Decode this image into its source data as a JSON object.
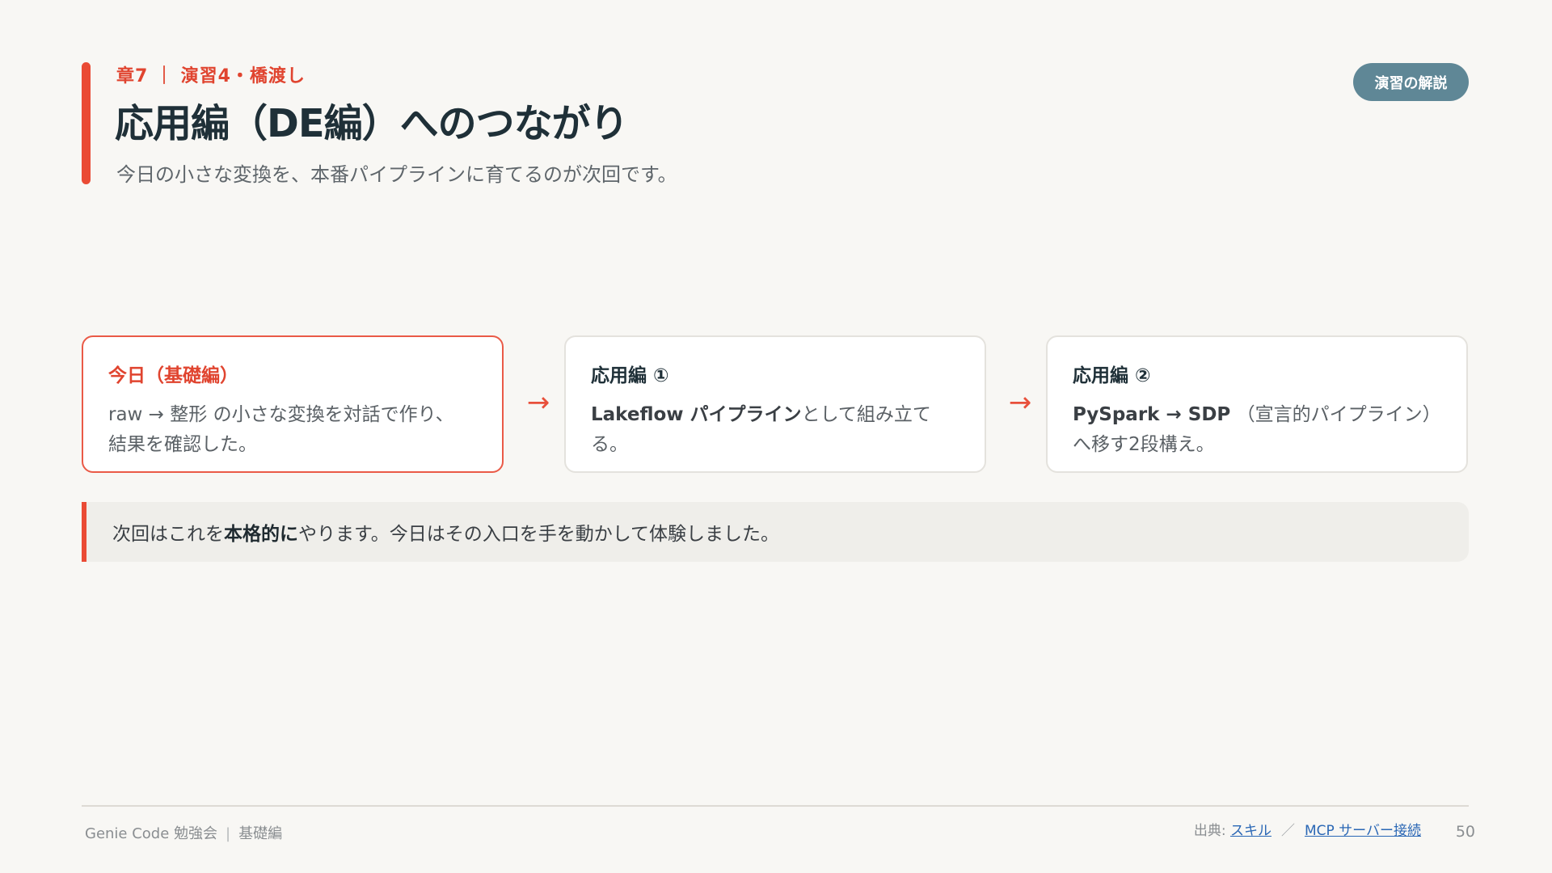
{
  "header": {
    "eyebrow": "章7 ｜ 演習4・橋渡し",
    "title": "応用編（DE編）へのつながり",
    "subtitle": "今日の小さな変換を、本番パイプラインに育てるのが次回です。",
    "badge": "演習の解説"
  },
  "flow": {
    "arrow": "→",
    "cards": [
      {
        "title": "今日（基礎編）",
        "body_line1": "raw → 整形 の小さな変換を対話で作り、",
        "body_line2": "結果を確認した。"
      },
      {
        "title": "応用編 ①",
        "body_bold": "Lakeflow パイプライン",
        "body_rest": "として組み立てる。"
      },
      {
        "title": "応用編 ②",
        "body_bold": "PySpark → SDP",
        "body_rest": " （宣言的パイプライン）",
        "body_line2": "へ移す2段構え。"
      }
    ]
  },
  "note": {
    "prefix": "次回はこれを",
    "bold": "本格的に",
    "suffix": "やります。今日はその入口を手を動かして体験しました。"
  },
  "footer": {
    "left_main": "Genie Code 勉強会",
    "left_sep": "|",
    "left_sub": "基礎編",
    "source_label": "出典: ",
    "link1": "スキル",
    "slash": "／",
    "link2": "MCP サーバー接続",
    "page": "50"
  },
  "colors": {
    "accent": "#ea4b35",
    "title": "#1f3038",
    "badge": "#5f8796",
    "link": "#2a67b5"
  }
}
